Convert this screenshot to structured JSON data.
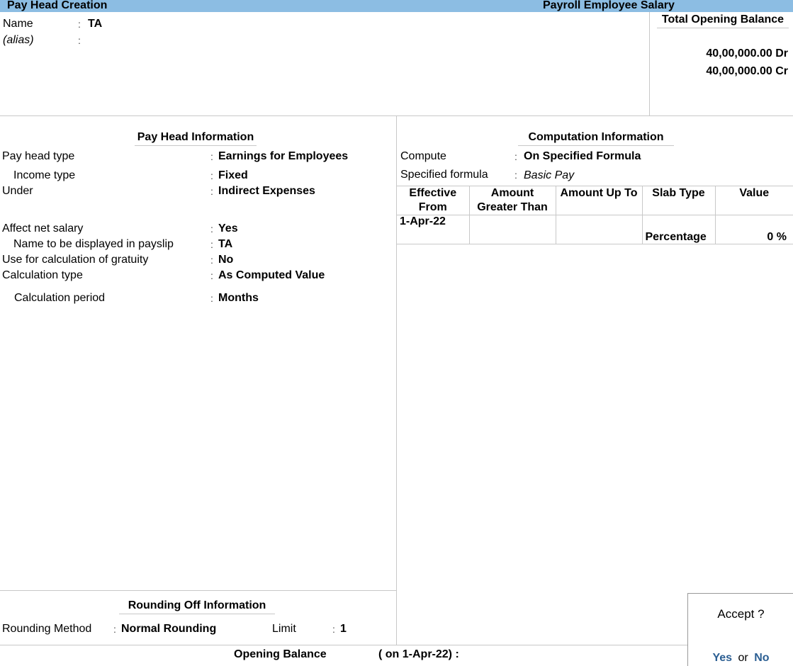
{
  "titlebar": {
    "left_title": "Pay Head  Creation",
    "center_title": "Payroll Employee Salary"
  },
  "header": {
    "name_label": "Name",
    "name_value": "TA",
    "alias_label": "(alias)",
    "alias_value": "",
    "colon": ":"
  },
  "total_opening_balance": {
    "title": "Total Opening Balance",
    "dr": "40,00,000.00 Dr",
    "cr": "40,00,000.00 Cr"
  },
  "pay_head_info": {
    "title": "Pay Head Information",
    "fields": [
      {
        "label": "Pay head type",
        "value": "Earnings for Employees"
      },
      {
        "label": "Income type",
        "value": "Fixed"
      },
      {
        "label": "Under",
        "value": "Indirect Expenses"
      },
      {
        "label": "Affect net salary",
        "value": "Yes"
      },
      {
        "label": "Name to be displayed in payslip",
        "value": "TA"
      },
      {
        "label": "Use for calculation of gratuity",
        "value": "No"
      },
      {
        "label": "Calculation type",
        "value": "As Computed Value"
      },
      {
        "label": "Calculation period",
        "value": "Months"
      }
    ]
  },
  "computation_info": {
    "title": "Computation Information",
    "compute_label": "Compute",
    "compute_value": "On Specified Formula",
    "formula_label": "Specified formula",
    "formula_value": "Basic Pay",
    "columns": [
      "Effective From",
      "Amount Greater Than",
      "Amount Up To",
      "Slab Type",
      "Value"
    ],
    "rows": [
      {
        "effective_from": "1-Apr-22",
        "amount_greater_than": "",
        "amount_up_to": "",
        "slab_type": "Percentage",
        "value": "0 %"
      }
    ]
  },
  "rounding_info": {
    "title": "Rounding Off Information",
    "method_label": "Rounding Method",
    "method_value": "Normal Rounding",
    "limit_label": "Limit",
    "limit_value": "1"
  },
  "opening_balance": {
    "label": "Opening Balance",
    "date_text": "( on 1-Apr-22)  :"
  },
  "accept_dialog": {
    "question": "Accept ?",
    "yes": "Yes",
    "or": "or",
    "no": "No"
  }
}
